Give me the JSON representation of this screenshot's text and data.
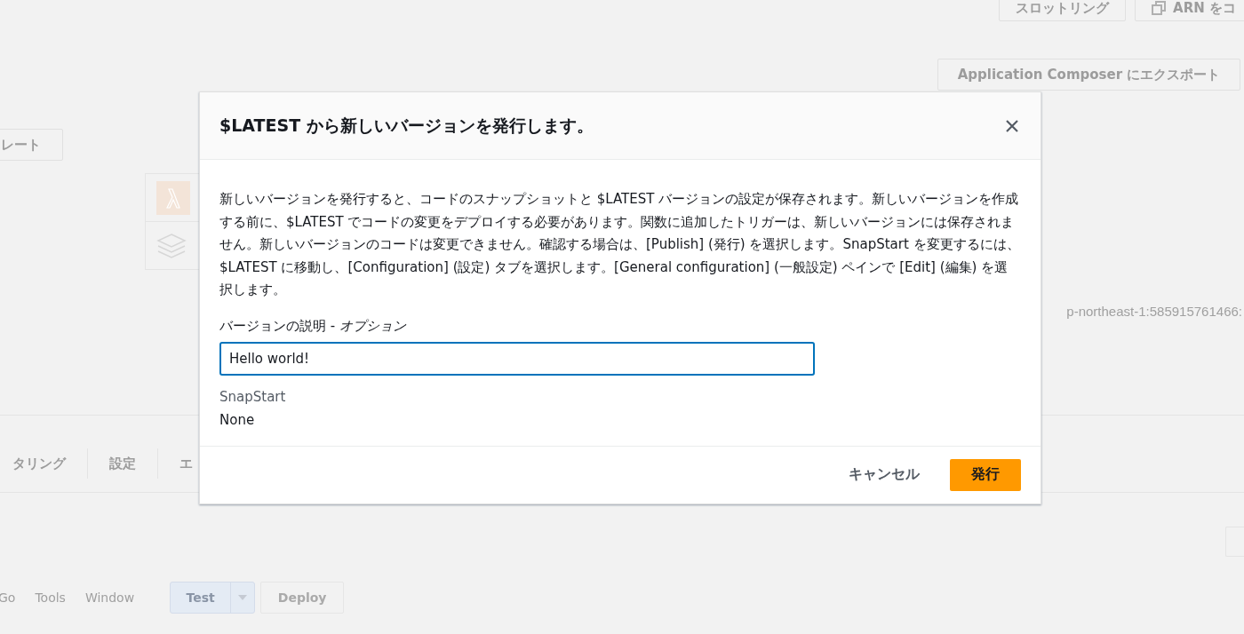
{
  "background": {
    "top_buttons": [
      {
        "label": "スロットリング",
        "icon": false
      },
      {
        "label": "ARN をコ",
        "icon": true
      }
    ],
    "export_button": "Application Composer にエクスポート",
    "left_button": "レート",
    "arn_text": "p-northeast-1:585915761466:",
    "tabs": [
      "タリング",
      "設定",
      "エ"
    ],
    "menu": [
      "Go",
      "Tools",
      "Window"
    ],
    "test_button": "Test",
    "deploy_button": {
      "label": "Deploy",
      "disabled": true
    }
  },
  "dialog": {
    "title": "$LATEST から新しいバージョンを発行します。",
    "description": "新しいバージョンを発行すると、コードのスナップショットと $LATEST バージョンの設定が保存されます。新しいバージョンを作成する前に、$LATEST でコードの変更をデプロイする必要があります。関数に追加したトリガーは、新しいバージョンには保存されません。新しいバージョンのコードは変更できません。確認する場合は、[Publish] (発行) を選択します。SnapStart を変更するには、$LATEST に移動し、[Configuration] (設定) タブを選択します。[General configuration] (一般設定) ペインで [Edit] (編集) を選択します。",
    "field_label": "バージョンの説明 - *オプション*",
    "field_value": "Hello world!",
    "snapstart_label": "SnapStart",
    "snapstart_value": "None",
    "cancel_button": "キャンセル",
    "publish_button": "発行"
  }
}
